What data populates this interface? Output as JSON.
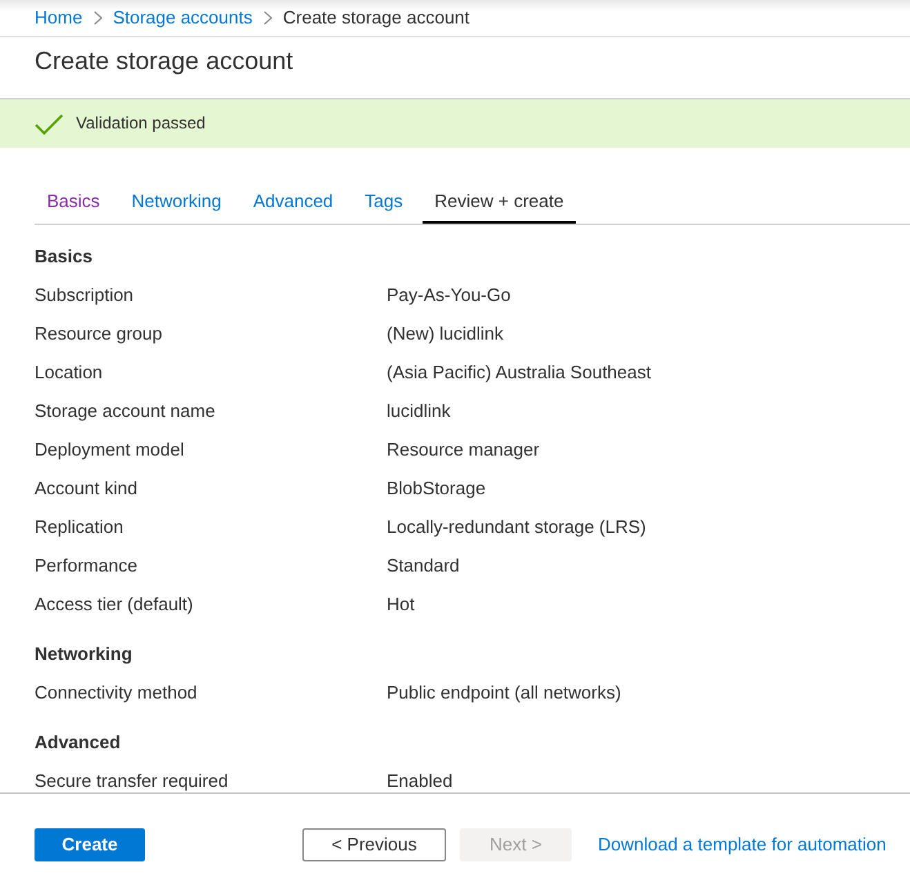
{
  "breadcrumb": [
    {
      "label": "Home",
      "current": false
    },
    {
      "label": "Storage accounts",
      "current": false
    },
    {
      "label": "Create storage account",
      "current": true
    }
  ],
  "page_title": "Create storage account",
  "banner": {
    "kind": "success",
    "message": "Validation passed"
  },
  "tabs": [
    {
      "label": "Basics",
      "selected": false,
      "visited": true
    },
    {
      "label": "Networking",
      "selected": false,
      "visited": false
    },
    {
      "label": "Advanced",
      "selected": false,
      "visited": false
    },
    {
      "label": "Tags",
      "selected": false,
      "visited": false
    },
    {
      "label": "Review + create",
      "selected": true,
      "visited": false
    }
  ],
  "sections": [
    {
      "title": "Basics",
      "rows": [
        {
          "label": "Subscription",
          "value": "Pay-As-You-Go"
        },
        {
          "label": "Resource group",
          "value": "(New) lucidlink"
        },
        {
          "label": "Location",
          "value": "(Asia Pacific) Australia Southeast"
        },
        {
          "label": "Storage account name",
          "value": "lucidlink"
        },
        {
          "label": "Deployment model",
          "value": "Resource manager"
        },
        {
          "label": "Account kind",
          "value": "BlobStorage"
        },
        {
          "label": "Replication",
          "value": "Locally-redundant storage (LRS)"
        },
        {
          "label": "Performance",
          "value": "Standard"
        },
        {
          "label": "Access tier (default)",
          "value": "Hot"
        }
      ]
    },
    {
      "title": "Networking",
      "rows": [
        {
          "label": "Connectivity method",
          "value": "Public endpoint (all networks)"
        }
      ]
    },
    {
      "title": "Advanced",
      "rows": [
        {
          "label": "Secure transfer required",
          "value": "Enabled"
        }
      ]
    }
  ],
  "footer": {
    "buttons": [
      {
        "label": "Create",
        "kind": "primary",
        "disabled": false
      },
      {
        "label": "< Previous",
        "kind": "back",
        "disabled": false
      },
      {
        "label": "Next >",
        "kind": "forward",
        "disabled": true
      }
    ],
    "link": "Download a template for automation"
  }
}
